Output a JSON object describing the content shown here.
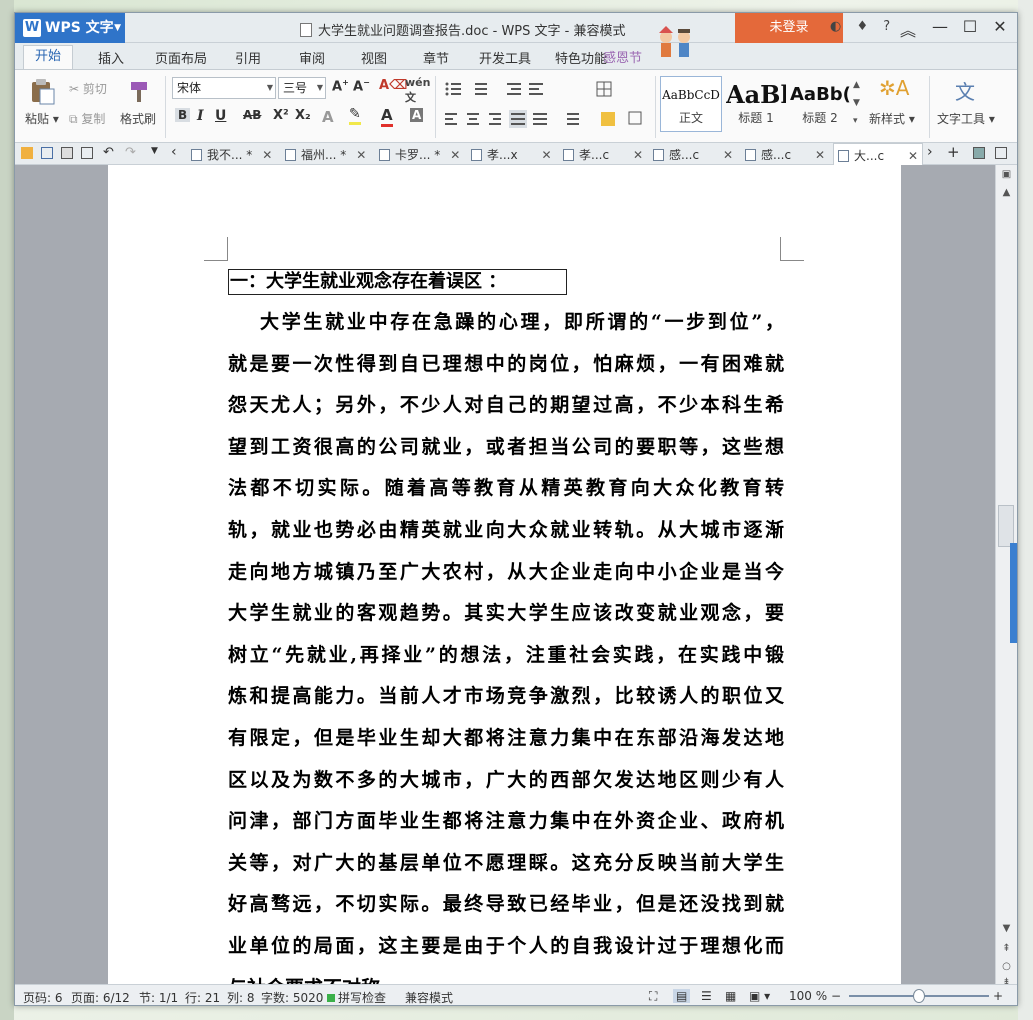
{
  "app": {
    "name": "WPS 文字",
    "window_title": "大学生就业问题调查报告.doc - WPS 文字 - 兼容模式",
    "login": "未登录"
  },
  "ribbon_tabs": [
    "开始",
    "插入",
    "页面布局",
    "引用",
    "审阅",
    "视图",
    "章节",
    "开发工具",
    "特色功能"
  ],
  "holiday_label": "感恩节",
  "clipboard": {
    "paste": "粘贴",
    "cut": "剪切",
    "copy": "复制",
    "format_painter": "格式刷"
  },
  "font": {
    "family": "宋体",
    "size": "三号"
  },
  "styles": [
    {
      "preview": "AaBbCcD",
      "label": "正文"
    },
    {
      "preview": "AaBl",
      "label": "标题 1"
    },
    {
      "preview": "AaBb(",
      "label": "标题 2"
    }
  ],
  "new_style": "新样式",
  "text_tools": "文字工具",
  "doc_tabs": [
    {
      "label": "我不...",
      "modified": "*"
    },
    {
      "label": "福州...",
      "modified": "*"
    },
    {
      "label": "卡罗...",
      "modified": "*"
    },
    {
      "label": "孝...x",
      "modified": ""
    },
    {
      "label": "孝...c",
      "modified": ""
    },
    {
      "label": "感...c",
      "modified": ""
    },
    {
      "label": "感...c",
      "modified": ""
    },
    {
      "label": "大...c",
      "modified": ""
    }
  ],
  "document": {
    "heading": "一：大学生就业观念存在着误区  ：",
    "lines": [
      "大学生就业中存在急躁的心理，即所谓的“一步到位”，",
      "就是要一次性得到自已理想中的岗位，怕麻烦，一有困难就",
      "怨天尤人；另外，不少人对自己的期望过高，不少本科生希",
      "望到工资很高的公司就业，或者担当公司的要职等，这些想",
      "法都不切实际。随着高等教育从精英教育向大众化教育转",
      "轨，就业也势必由精英就业向大众就业转轨。从大城市逐渐",
      "走向地方城镇乃至广大农村，从大企业走向中小企业是当今",
      "大学生就业的客观趋势。其实大学生应该改变就业观念，要",
      "树立“先就业,再择业”的想法，注重社会实践，在实践中锻",
      "炼和提高能力。当前人才市场竞争激烈，比较诱人的职位又",
      "有限定，但是毕业生却大都将注意力集中在东部沿海发达地",
      "区以及为数不多的大城市，广大的西部欠发达地区则少有人",
      "问津，部门方面毕业生都将注意力集中在外资企业、政府机",
      "关等，对广大的基层单位不愿理睬。这充分反映当前大学生",
      "好高骛远，不切实际。最终导致已经毕业，但是还没找到就",
      "业单位的局面，这主要是由于个人的自我设计过于理想化而",
      "与社会要求不对称。"
    ]
  },
  "status": {
    "page_num": "页码: 6",
    "page": "页面: 6/12",
    "section": "节: 1/1",
    "row": "行: 21",
    "col": "列: 8",
    "words": "字数: 5020",
    "spell": "拼写检查",
    "compat": "兼容模式",
    "zoom": "100 %",
    "zoom_level": 0.5
  },
  "colors": {
    "app_blue": "#2f74c9",
    "login_orange": "#e4693a",
    "doc_bg": "#a6aab1"
  }
}
